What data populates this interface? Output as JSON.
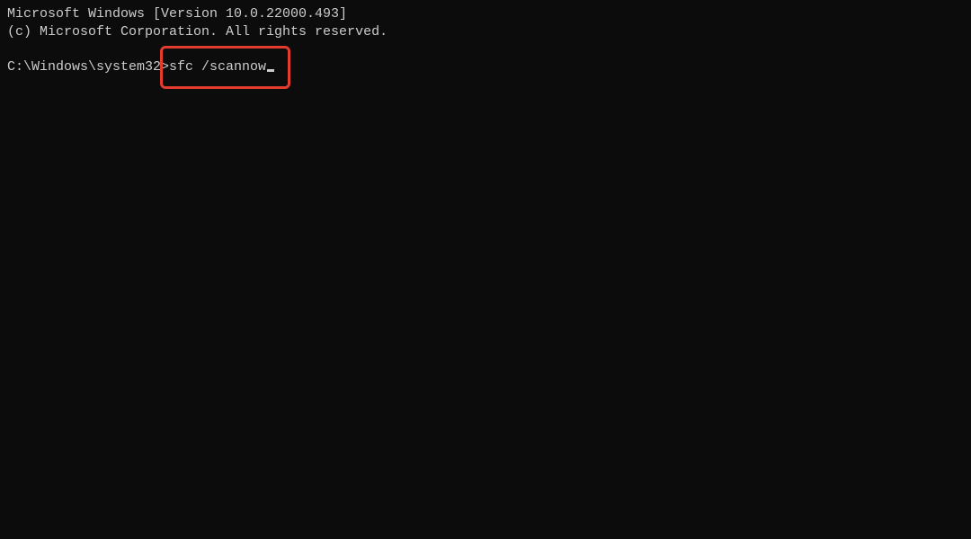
{
  "terminal": {
    "header_line_1": "Microsoft Windows [Version 10.0.22000.493]",
    "header_line_2": "(c) Microsoft Corporation. All rights reserved.",
    "prompt": "C:\\Windows\\system32>",
    "command": "sfc /scannow"
  },
  "annotation": {
    "highlight_color": "#e33b2e"
  }
}
